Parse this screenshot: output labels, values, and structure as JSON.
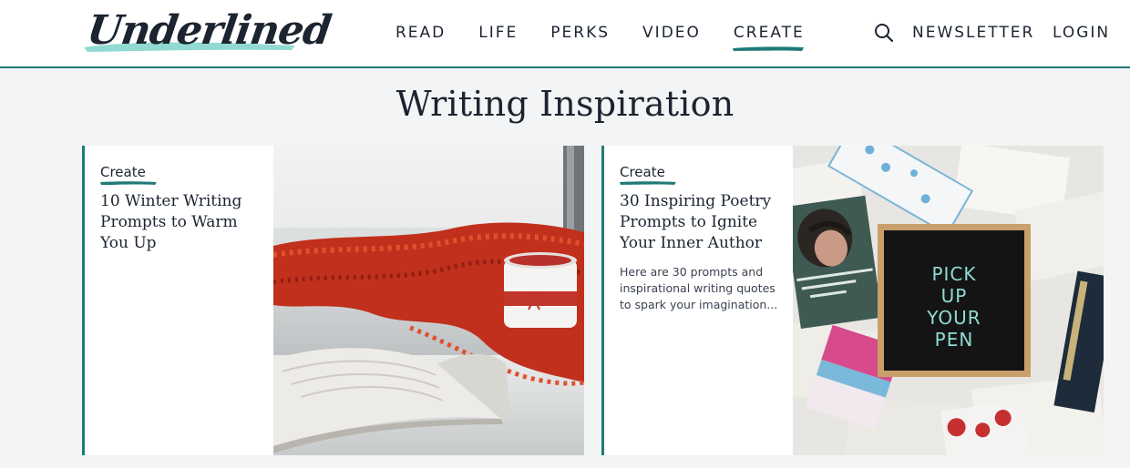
{
  "header": {
    "logo_text": "Underlined",
    "nav": [
      "READ",
      "LIFE",
      "PERKS",
      "VIDEO",
      "CREATE"
    ],
    "active_nav": "CREATE",
    "newsletter_label": "NEWSLETTER",
    "login_label": "LOGIN",
    "search_icon": "search-icon"
  },
  "page": {
    "title": "Writing Inspiration"
  },
  "cards": [
    {
      "tag": "Create",
      "title": "10 Winter Writing Prompts to Warm You Up",
      "excerpt": ""
    },
    {
      "tag": "Create",
      "title": "30 Inspiring Poetry Prompts to Ignite Your Inner Author",
      "excerpt": "Here are 30 prompts and inspirational writing quotes to spark your imagination...",
      "board_text": [
        "PICK",
        "UP",
        "YOUR",
        "PEN"
      ]
    }
  ],
  "colors": {
    "accent": "#1f7a78",
    "text": "#1b2430",
    "background": "#f3f4f5"
  }
}
